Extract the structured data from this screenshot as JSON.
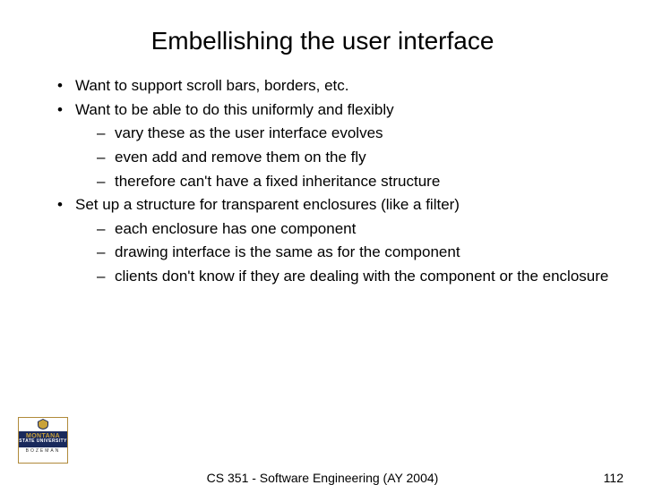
{
  "title": "Embellishing the user interface",
  "bullets": {
    "b1": "Want to support scroll bars, borders, etc.",
    "b2": "Want to be able to do this uniformly and flexibly",
    "b2s1": "vary these as the user interface evolves",
    "b2s2": "even add and remove them on the fly",
    "b2s3": "therefore can't have a fixed inheritance structure",
    "b3": "Set up a structure for transparent enclosures (like a filter)",
    "b3s1": "each enclosure has one component",
    "b3s2": "drawing interface is the same as for the component",
    "b3s3": "clients don't know if they are dealing with the component or the enclosure"
  },
  "footer": {
    "center": "CS 351 - Software Engineering (AY 2004)",
    "page": "112"
  },
  "logo": {
    "line1": "MONTANA",
    "line2": "STATE UNIVERSITY",
    "city": "BOZEMAN"
  }
}
